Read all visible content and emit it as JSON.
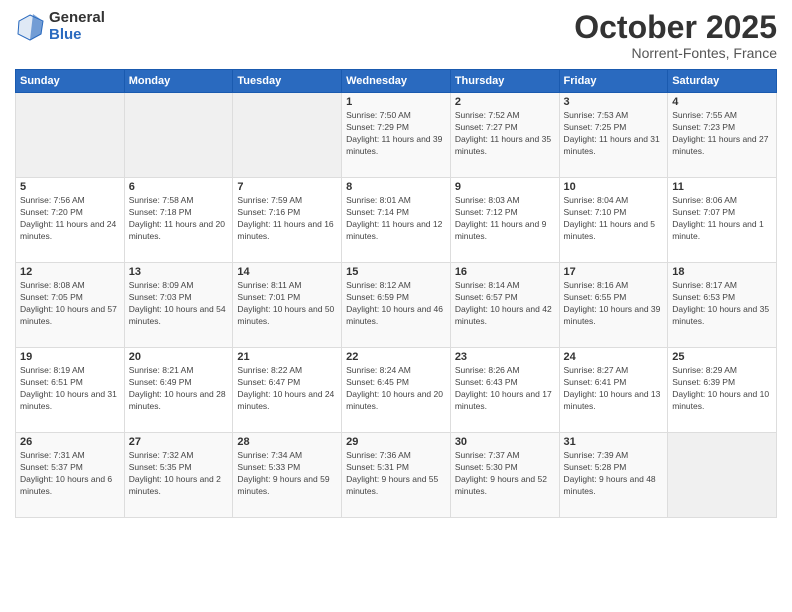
{
  "logo": {
    "general": "General",
    "blue": "Blue"
  },
  "title": {
    "month_year": "October 2025",
    "location": "Norrent-Fontes, France"
  },
  "weekdays": [
    "Sunday",
    "Monday",
    "Tuesday",
    "Wednesday",
    "Thursday",
    "Friday",
    "Saturday"
  ],
  "weeks": [
    [
      {
        "day": "",
        "sunrise": "",
        "sunset": "",
        "daylight": ""
      },
      {
        "day": "",
        "sunrise": "",
        "sunset": "",
        "daylight": ""
      },
      {
        "day": "",
        "sunrise": "",
        "sunset": "",
        "daylight": ""
      },
      {
        "day": "1",
        "sunrise": "Sunrise: 7:50 AM",
        "sunset": "Sunset: 7:29 PM",
        "daylight": "Daylight: 11 hours and 39 minutes."
      },
      {
        "day": "2",
        "sunrise": "Sunrise: 7:52 AM",
        "sunset": "Sunset: 7:27 PM",
        "daylight": "Daylight: 11 hours and 35 minutes."
      },
      {
        "day": "3",
        "sunrise": "Sunrise: 7:53 AM",
        "sunset": "Sunset: 7:25 PM",
        "daylight": "Daylight: 11 hours and 31 minutes."
      },
      {
        "day": "4",
        "sunrise": "Sunrise: 7:55 AM",
        "sunset": "Sunset: 7:23 PM",
        "daylight": "Daylight: 11 hours and 27 minutes."
      }
    ],
    [
      {
        "day": "5",
        "sunrise": "Sunrise: 7:56 AM",
        "sunset": "Sunset: 7:20 PM",
        "daylight": "Daylight: 11 hours and 24 minutes."
      },
      {
        "day": "6",
        "sunrise": "Sunrise: 7:58 AM",
        "sunset": "Sunset: 7:18 PM",
        "daylight": "Daylight: 11 hours and 20 minutes."
      },
      {
        "day": "7",
        "sunrise": "Sunrise: 7:59 AM",
        "sunset": "Sunset: 7:16 PM",
        "daylight": "Daylight: 11 hours and 16 minutes."
      },
      {
        "day": "8",
        "sunrise": "Sunrise: 8:01 AM",
        "sunset": "Sunset: 7:14 PM",
        "daylight": "Daylight: 11 hours and 12 minutes."
      },
      {
        "day": "9",
        "sunrise": "Sunrise: 8:03 AM",
        "sunset": "Sunset: 7:12 PM",
        "daylight": "Daylight: 11 hours and 9 minutes."
      },
      {
        "day": "10",
        "sunrise": "Sunrise: 8:04 AM",
        "sunset": "Sunset: 7:10 PM",
        "daylight": "Daylight: 11 hours and 5 minutes."
      },
      {
        "day": "11",
        "sunrise": "Sunrise: 8:06 AM",
        "sunset": "Sunset: 7:07 PM",
        "daylight": "Daylight: 11 hours and 1 minute."
      }
    ],
    [
      {
        "day": "12",
        "sunrise": "Sunrise: 8:08 AM",
        "sunset": "Sunset: 7:05 PM",
        "daylight": "Daylight: 10 hours and 57 minutes."
      },
      {
        "day": "13",
        "sunrise": "Sunrise: 8:09 AM",
        "sunset": "Sunset: 7:03 PM",
        "daylight": "Daylight: 10 hours and 54 minutes."
      },
      {
        "day": "14",
        "sunrise": "Sunrise: 8:11 AM",
        "sunset": "Sunset: 7:01 PM",
        "daylight": "Daylight: 10 hours and 50 minutes."
      },
      {
        "day": "15",
        "sunrise": "Sunrise: 8:12 AM",
        "sunset": "Sunset: 6:59 PM",
        "daylight": "Daylight: 10 hours and 46 minutes."
      },
      {
        "day": "16",
        "sunrise": "Sunrise: 8:14 AM",
        "sunset": "Sunset: 6:57 PM",
        "daylight": "Daylight: 10 hours and 42 minutes."
      },
      {
        "day": "17",
        "sunrise": "Sunrise: 8:16 AM",
        "sunset": "Sunset: 6:55 PM",
        "daylight": "Daylight: 10 hours and 39 minutes."
      },
      {
        "day": "18",
        "sunrise": "Sunrise: 8:17 AM",
        "sunset": "Sunset: 6:53 PM",
        "daylight": "Daylight: 10 hours and 35 minutes."
      }
    ],
    [
      {
        "day": "19",
        "sunrise": "Sunrise: 8:19 AM",
        "sunset": "Sunset: 6:51 PM",
        "daylight": "Daylight: 10 hours and 31 minutes."
      },
      {
        "day": "20",
        "sunrise": "Sunrise: 8:21 AM",
        "sunset": "Sunset: 6:49 PM",
        "daylight": "Daylight: 10 hours and 28 minutes."
      },
      {
        "day": "21",
        "sunrise": "Sunrise: 8:22 AM",
        "sunset": "Sunset: 6:47 PM",
        "daylight": "Daylight: 10 hours and 24 minutes."
      },
      {
        "day": "22",
        "sunrise": "Sunrise: 8:24 AM",
        "sunset": "Sunset: 6:45 PM",
        "daylight": "Daylight: 10 hours and 20 minutes."
      },
      {
        "day": "23",
        "sunrise": "Sunrise: 8:26 AM",
        "sunset": "Sunset: 6:43 PM",
        "daylight": "Daylight: 10 hours and 17 minutes."
      },
      {
        "day": "24",
        "sunrise": "Sunrise: 8:27 AM",
        "sunset": "Sunset: 6:41 PM",
        "daylight": "Daylight: 10 hours and 13 minutes."
      },
      {
        "day": "25",
        "sunrise": "Sunrise: 8:29 AM",
        "sunset": "Sunset: 6:39 PM",
        "daylight": "Daylight: 10 hours and 10 minutes."
      }
    ],
    [
      {
        "day": "26",
        "sunrise": "Sunrise: 7:31 AM",
        "sunset": "Sunset: 5:37 PM",
        "daylight": "Daylight: 10 hours and 6 minutes."
      },
      {
        "day": "27",
        "sunrise": "Sunrise: 7:32 AM",
        "sunset": "Sunset: 5:35 PM",
        "daylight": "Daylight: 10 hours and 2 minutes."
      },
      {
        "day": "28",
        "sunrise": "Sunrise: 7:34 AM",
        "sunset": "Sunset: 5:33 PM",
        "daylight": "Daylight: 9 hours and 59 minutes."
      },
      {
        "day": "29",
        "sunrise": "Sunrise: 7:36 AM",
        "sunset": "Sunset: 5:31 PM",
        "daylight": "Daylight: 9 hours and 55 minutes."
      },
      {
        "day": "30",
        "sunrise": "Sunrise: 7:37 AM",
        "sunset": "Sunset: 5:30 PM",
        "daylight": "Daylight: 9 hours and 52 minutes."
      },
      {
        "day": "31",
        "sunrise": "Sunrise: 7:39 AM",
        "sunset": "Sunset: 5:28 PM",
        "daylight": "Daylight: 9 hours and 48 minutes."
      },
      {
        "day": "",
        "sunrise": "",
        "sunset": "",
        "daylight": ""
      }
    ]
  ]
}
